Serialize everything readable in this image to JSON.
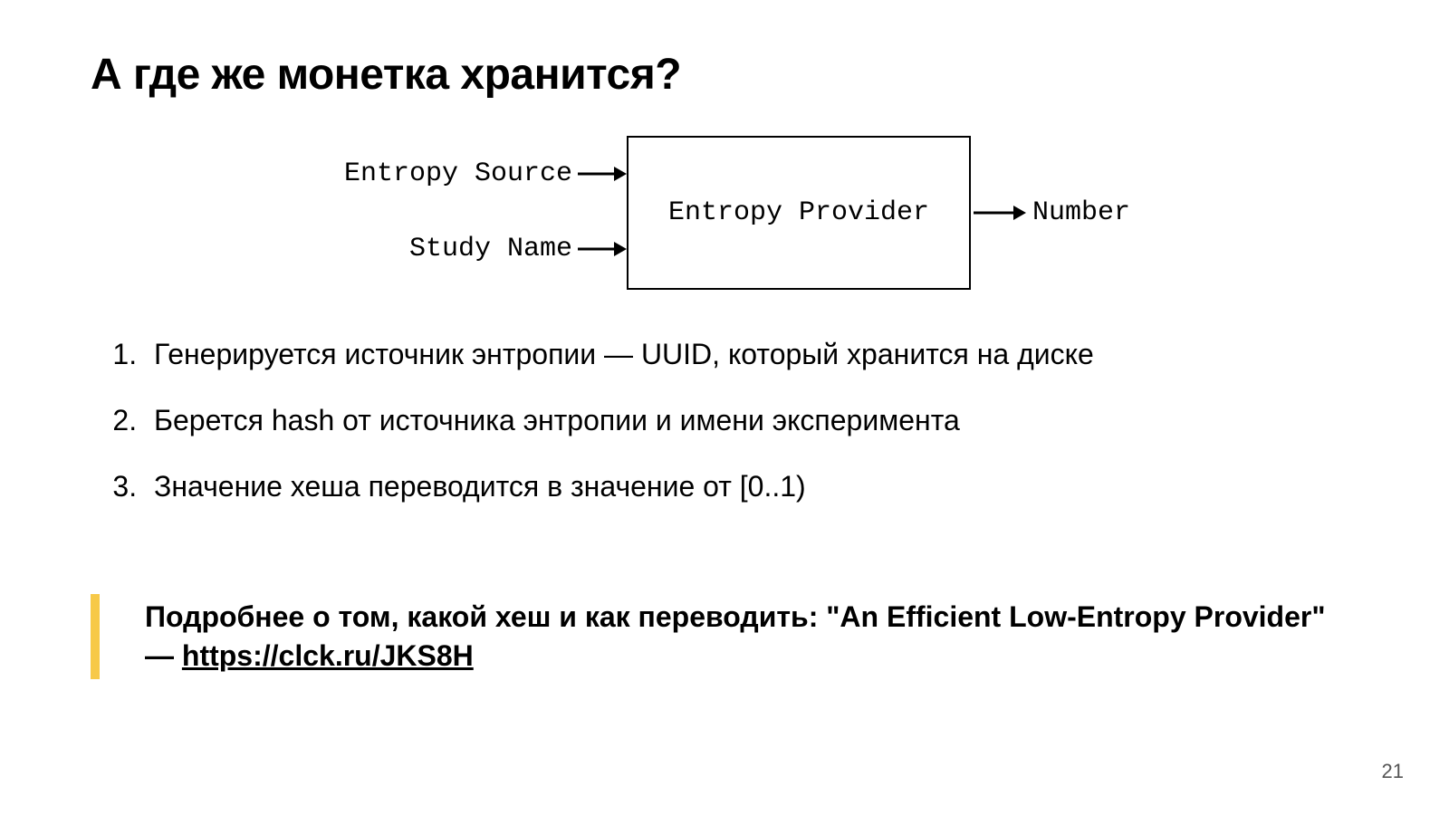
{
  "title": "А где же монетка хранится?",
  "diagram": {
    "input1": "Entropy Source",
    "input2": "Study Name",
    "box": "Entropy Provider",
    "output": "Number"
  },
  "list": {
    "item1": "Генерируется источник энтропии — UUID, который хранится на диске",
    "item2": "Берется hash от источника энтропии и имени эксперимента",
    "item3": "Значение хеша переводится в значение от [0..1)"
  },
  "callout": {
    "prefix": "Подробнее о том, какой хеш и как переводить: \"An Efficient Low-Entropy Provider\" — ",
    "link_text": "https://clck.ru/JKS8H"
  },
  "page_number": "21"
}
